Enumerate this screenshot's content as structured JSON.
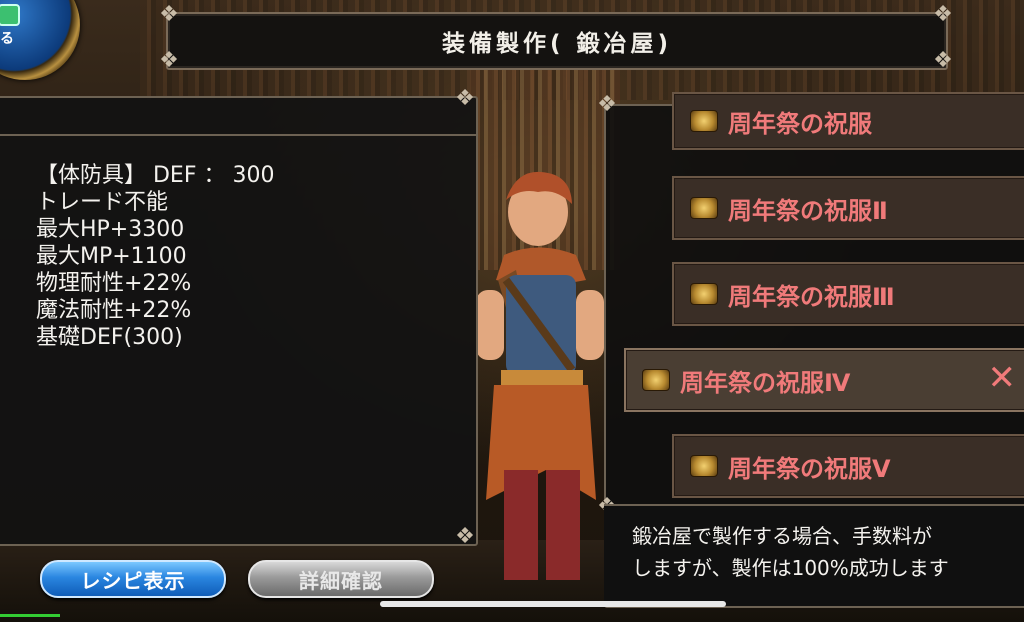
{
  "header": {
    "title": "装備製作( 鍛冶屋)"
  },
  "badge": {
    "label": "る"
  },
  "item_detail": {
    "lines": [
      "【体防具】 DEF ： 300",
      "トレード不能",
      "最大HP+3300",
      "最大MP+1100",
      "物理耐性+22%",
      "魔法耐性+22%",
      "基礎DEF(300)"
    ]
  },
  "recipe_list": [
    {
      "name": "周年祭の祝服",
      "selected": false
    },
    {
      "name": "周年祭の祝服Ⅱ",
      "selected": false
    },
    {
      "name": "周年祭の祝服Ⅲ",
      "selected": false
    },
    {
      "name": "周年祭の祝服Ⅳ",
      "selected": true
    },
    {
      "name": "周年祭の祝服Ⅴ",
      "selected": false
    }
  ],
  "description": {
    "line1": "鍛冶屋で製作する場合、手数料が",
    "line2": "しますが、製作は100%成功します"
  },
  "buttons": {
    "recipe": "レシピ表示",
    "detail": "詳細確認"
  },
  "colors": {
    "item_text": "#f07a7a",
    "recipe_button": "#2a86e0",
    "detail_button": "#9a9a9a"
  },
  "icons": {
    "item": "scroll-icon",
    "close": "close-x-icon"
  }
}
